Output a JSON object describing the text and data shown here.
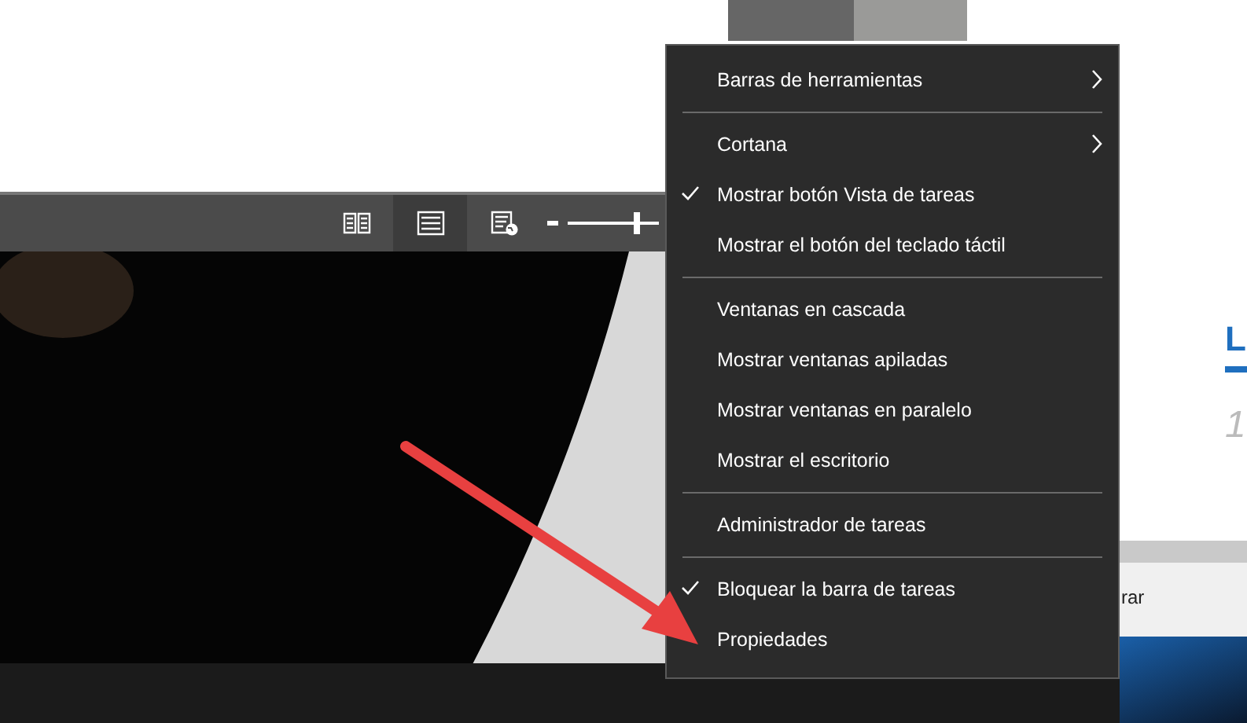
{
  "toolbar": {
    "buttons": [
      {
        "kind": "reading",
        "selected": false
      },
      {
        "kind": "list",
        "selected": true
      },
      {
        "kind": "web",
        "selected": false
      }
    ],
    "zoom_slider": {
      "level": 0.76
    }
  },
  "menu": {
    "items": [
      {
        "kind": "item",
        "label": "Barras de herramientas",
        "checked": false,
        "submenu": true
      },
      {
        "kind": "separator"
      },
      {
        "kind": "item",
        "label": "Cortana",
        "checked": false,
        "submenu": true
      },
      {
        "kind": "item",
        "label": "Mostrar botón Vista de tareas",
        "checked": true,
        "submenu": false
      },
      {
        "kind": "item",
        "label": "Mostrar el botón del teclado táctil",
        "checked": false,
        "submenu": false
      },
      {
        "kind": "separator"
      },
      {
        "kind": "item",
        "label": "Ventanas en cascada",
        "checked": false,
        "submenu": false
      },
      {
        "kind": "item",
        "label": "Mostrar ventanas apiladas",
        "checked": false,
        "submenu": false
      },
      {
        "kind": "item",
        "label": "Mostrar ventanas en paralelo",
        "checked": false,
        "submenu": false
      },
      {
        "kind": "item",
        "label": "Mostrar el escritorio",
        "checked": false,
        "submenu": false
      },
      {
        "kind": "separator"
      },
      {
        "kind": "item",
        "label": "Administrador de tareas",
        "checked": false,
        "submenu": false
      },
      {
        "kind": "separator"
      },
      {
        "kind": "item",
        "label": "Bloquear la barra de tareas",
        "checked": true,
        "submenu": false
      },
      {
        "kind": "item",
        "label": "Propiedades",
        "checked": false,
        "submenu": false
      }
    ]
  },
  "document": {
    "heading": "L",
    "number": "1",
    "status_text": "rar"
  }
}
